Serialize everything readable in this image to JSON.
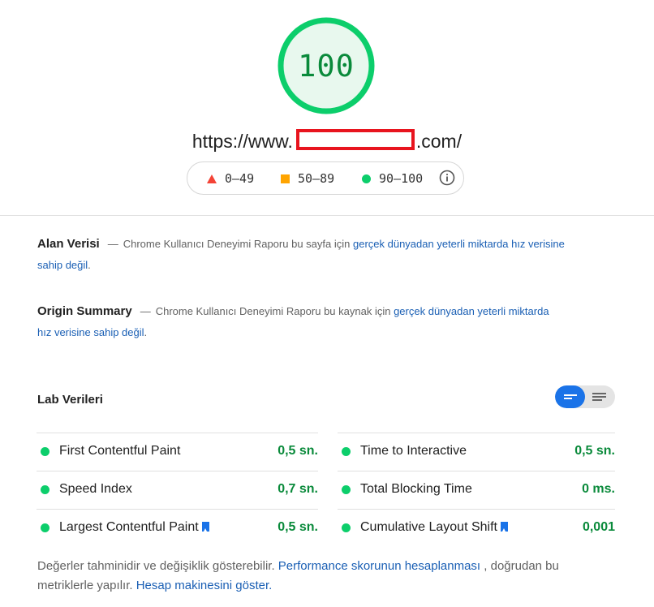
{
  "score": {
    "value": "100",
    "fraction": 1.0,
    "color": "#0cce6b"
  },
  "url": {
    "prefix": "https://www.",
    "suffix": ".com/",
    "redaction_color": "#e8141e"
  },
  "legend": {
    "items": [
      {
        "label": "0–49",
        "icon": "triangle-icon",
        "color": "#f44336"
      },
      {
        "label": "50–89",
        "icon": "square-icon",
        "color": "#ffa400"
      },
      {
        "label": "90–100",
        "icon": "circle-icon",
        "color": "#0cce6b"
      }
    ],
    "info_icon": "info-icon"
  },
  "field_data": {
    "title": "Alan Verisi",
    "dash": "—",
    "text": "Chrome Kullanıcı Deneyimi Raporu bu sayfa için",
    "link": "gerçek dünyadan yeterli miktarda hız verisine sahip değil",
    "end": "."
  },
  "origin_summary": {
    "title": "Origin Summary",
    "dash": "—",
    "text": "Chrome Kullanıcı Deneyimi Raporu bu kaynak için",
    "link": "gerçek dünyadan yeterli miktarda hız verisine sahip değil",
    "end": "."
  },
  "lab": {
    "title": "Lab Verileri",
    "toggle": {
      "active": "compact-view",
      "active_color": "#1a73e8"
    },
    "metrics_left": [
      {
        "name": "First Contentful Paint",
        "value": "0,5 sn.",
        "bookmark": false
      },
      {
        "name": "Speed Index",
        "value": "0,7 sn.",
        "bookmark": false
      },
      {
        "name": "Largest Contentful Paint",
        "value": "0,5 sn.",
        "bookmark": true
      }
    ],
    "metrics_right": [
      {
        "name": "Time to Interactive",
        "value": "0,5 sn.",
        "bookmark": false
      },
      {
        "name": "Total Blocking Time",
        "value": "0 ms.",
        "bookmark": false
      },
      {
        "name": "Cumulative Layout Shift",
        "value": "0,001",
        "bookmark": true
      }
    ],
    "status_color": "#0cce6b"
  },
  "footer": {
    "text1": "Değerler tahminidir ve değişiklik gösterebilir.",
    "link1": "Performance skorunun hesaplanması",
    "text2": ", doğrudan bu metriklerle yapılır.",
    "link2": "Hesap makinesini göster."
  }
}
